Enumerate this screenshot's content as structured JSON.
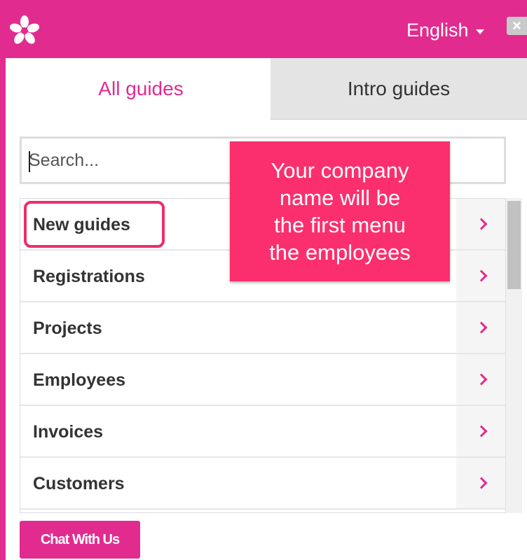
{
  "header": {
    "language": "English",
    "close_label": "×"
  },
  "tabs": [
    {
      "label": "All guides",
      "active": true
    },
    {
      "label": "Intro guides",
      "active": false
    }
  ],
  "search": {
    "placeholder": "Search...",
    "value": ""
  },
  "menu": {
    "items": [
      {
        "label": "New guides"
      },
      {
        "label": "Registrations"
      },
      {
        "label": "Projects"
      },
      {
        "label": "Employees"
      },
      {
        "label": "Invoices"
      },
      {
        "label": "Customers"
      }
    ]
  },
  "callout": {
    "lines": [
      "Your company",
      "name will be",
      "the first menu",
      "the employees"
    ]
  },
  "footer": {
    "chat_label": "Chat With Us"
  },
  "colors": {
    "brand": "#e22b8e",
    "callout": "#fb2f6d",
    "highlight": "#ec2e6a"
  },
  "icons": {
    "logo": "flower-logo-icon",
    "language": "caret-down-icon",
    "close": "close-icon",
    "row_arrow": "chevron-right-icon"
  }
}
